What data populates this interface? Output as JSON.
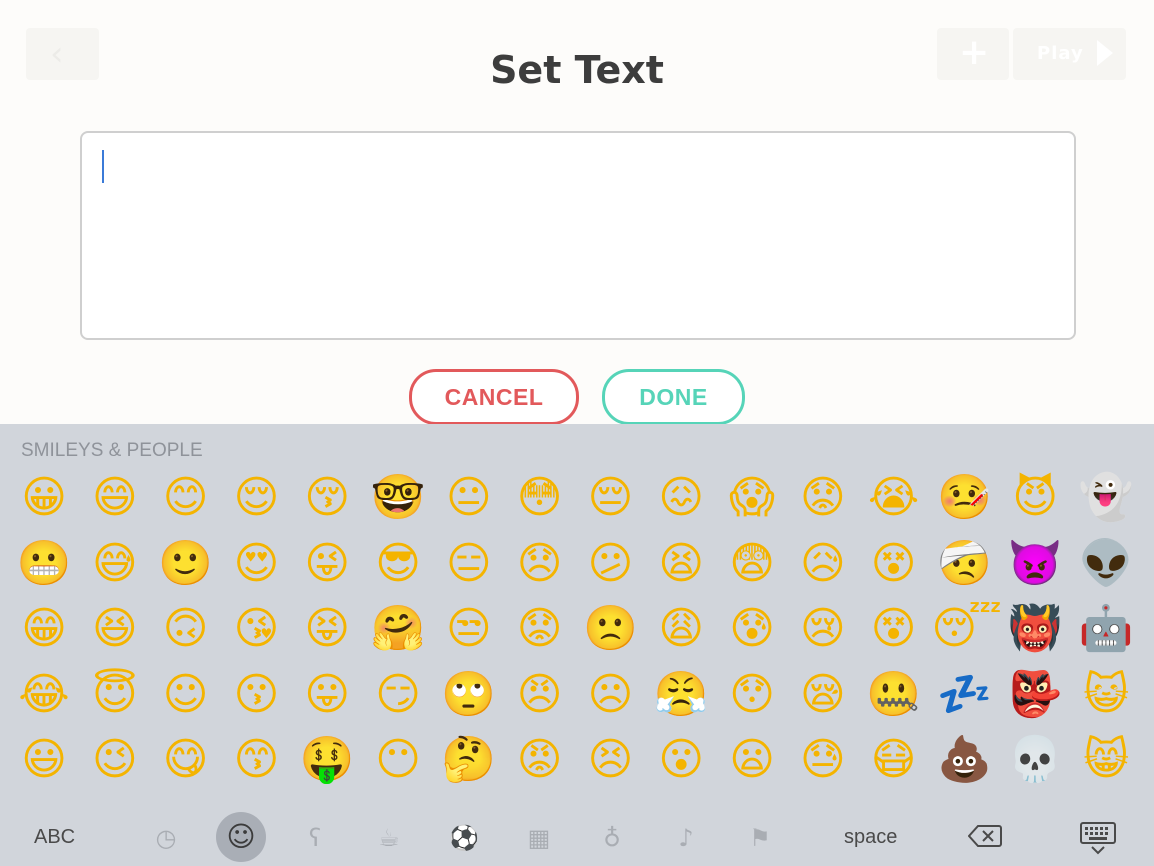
{
  "header": {
    "title": "Set Text",
    "back_glyph": "‹",
    "plus_glyph": "+",
    "play_label": "Play"
  },
  "text_field": {
    "value": ""
  },
  "buttons": {
    "cancel": "CANCEL",
    "done": "DONE"
  },
  "keyboard": {
    "section_label": "SMILEYS & PEOPLE",
    "abc_label": "ABC",
    "space_label": "space",
    "categories": [
      {
        "icon": "clock-icon",
        "glyph": "◷"
      },
      {
        "icon": "smiley-icon",
        "glyph": "☺"
      },
      {
        "icon": "bear-icon",
        "glyph": "ʕ"
      },
      {
        "icon": "food-icon",
        "glyph": "☕"
      },
      {
        "icon": "soccer-ball-icon",
        "glyph": "⚽"
      },
      {
        "icon": "building-icon",
        "glyph": "▦"
      },
      {
        "icon": "lightbulb-icon",
        "glyph": "♁"
      },
      {
        "icon": "symbols-icon",
        "glyph": "♪"
      },
      {
        "icon": "flag-icon",
        "glyph": "⚑"
      }
    ],
    "emoji_rows": [
      [
        "😀",
        "😄",
        "😊",
        "😌",
        "😚",
        "🤓",
        "😐",
        "😳",
        "😔",
        "😖",
        "😱",
        "😟",
        "😭",
        "🤒",
        "😈",
        "👻"
      ],
      [
        "😬",
        "😅",
        "🙂",
        "😍",
        "😜",
        "😎",
        "😑",
        "😞",
        "😕",
        "😫",
        "😨",
        "😥",
        "😵",
        "🤕",
        "👿",
        "👽"
      ],
      [
        "😁",
        "😆",
        "🙃",
        "😘",
        "😝",
        "🤗",
        "😒",
        "😟",
        "🙁",
        "😩",
        "😰",
        "😢",
        "😵",
        "😴",
        "👹",
        "🤖"
      ],
      [
        "😂",
        "😇",
        "☺",
        "😗",
        "😛",
        "😏",
        "🙄",
        "😠",
        "☹",
        "😤",
        "😯",
        "😪",
        "🤐",
        "💤",
        "👺",
        "😺"
      ],
      [
        "😃",
        "😉",
        "😋",
        "😙",
        "🤑",
        "😶",
        "🤔",
        "😡",
        "😣",
        "😮",
        "😦",
        "😓",
        "😷",
        "💩",
        "💀",
        "😸"
      ]
    ]
  }
}
